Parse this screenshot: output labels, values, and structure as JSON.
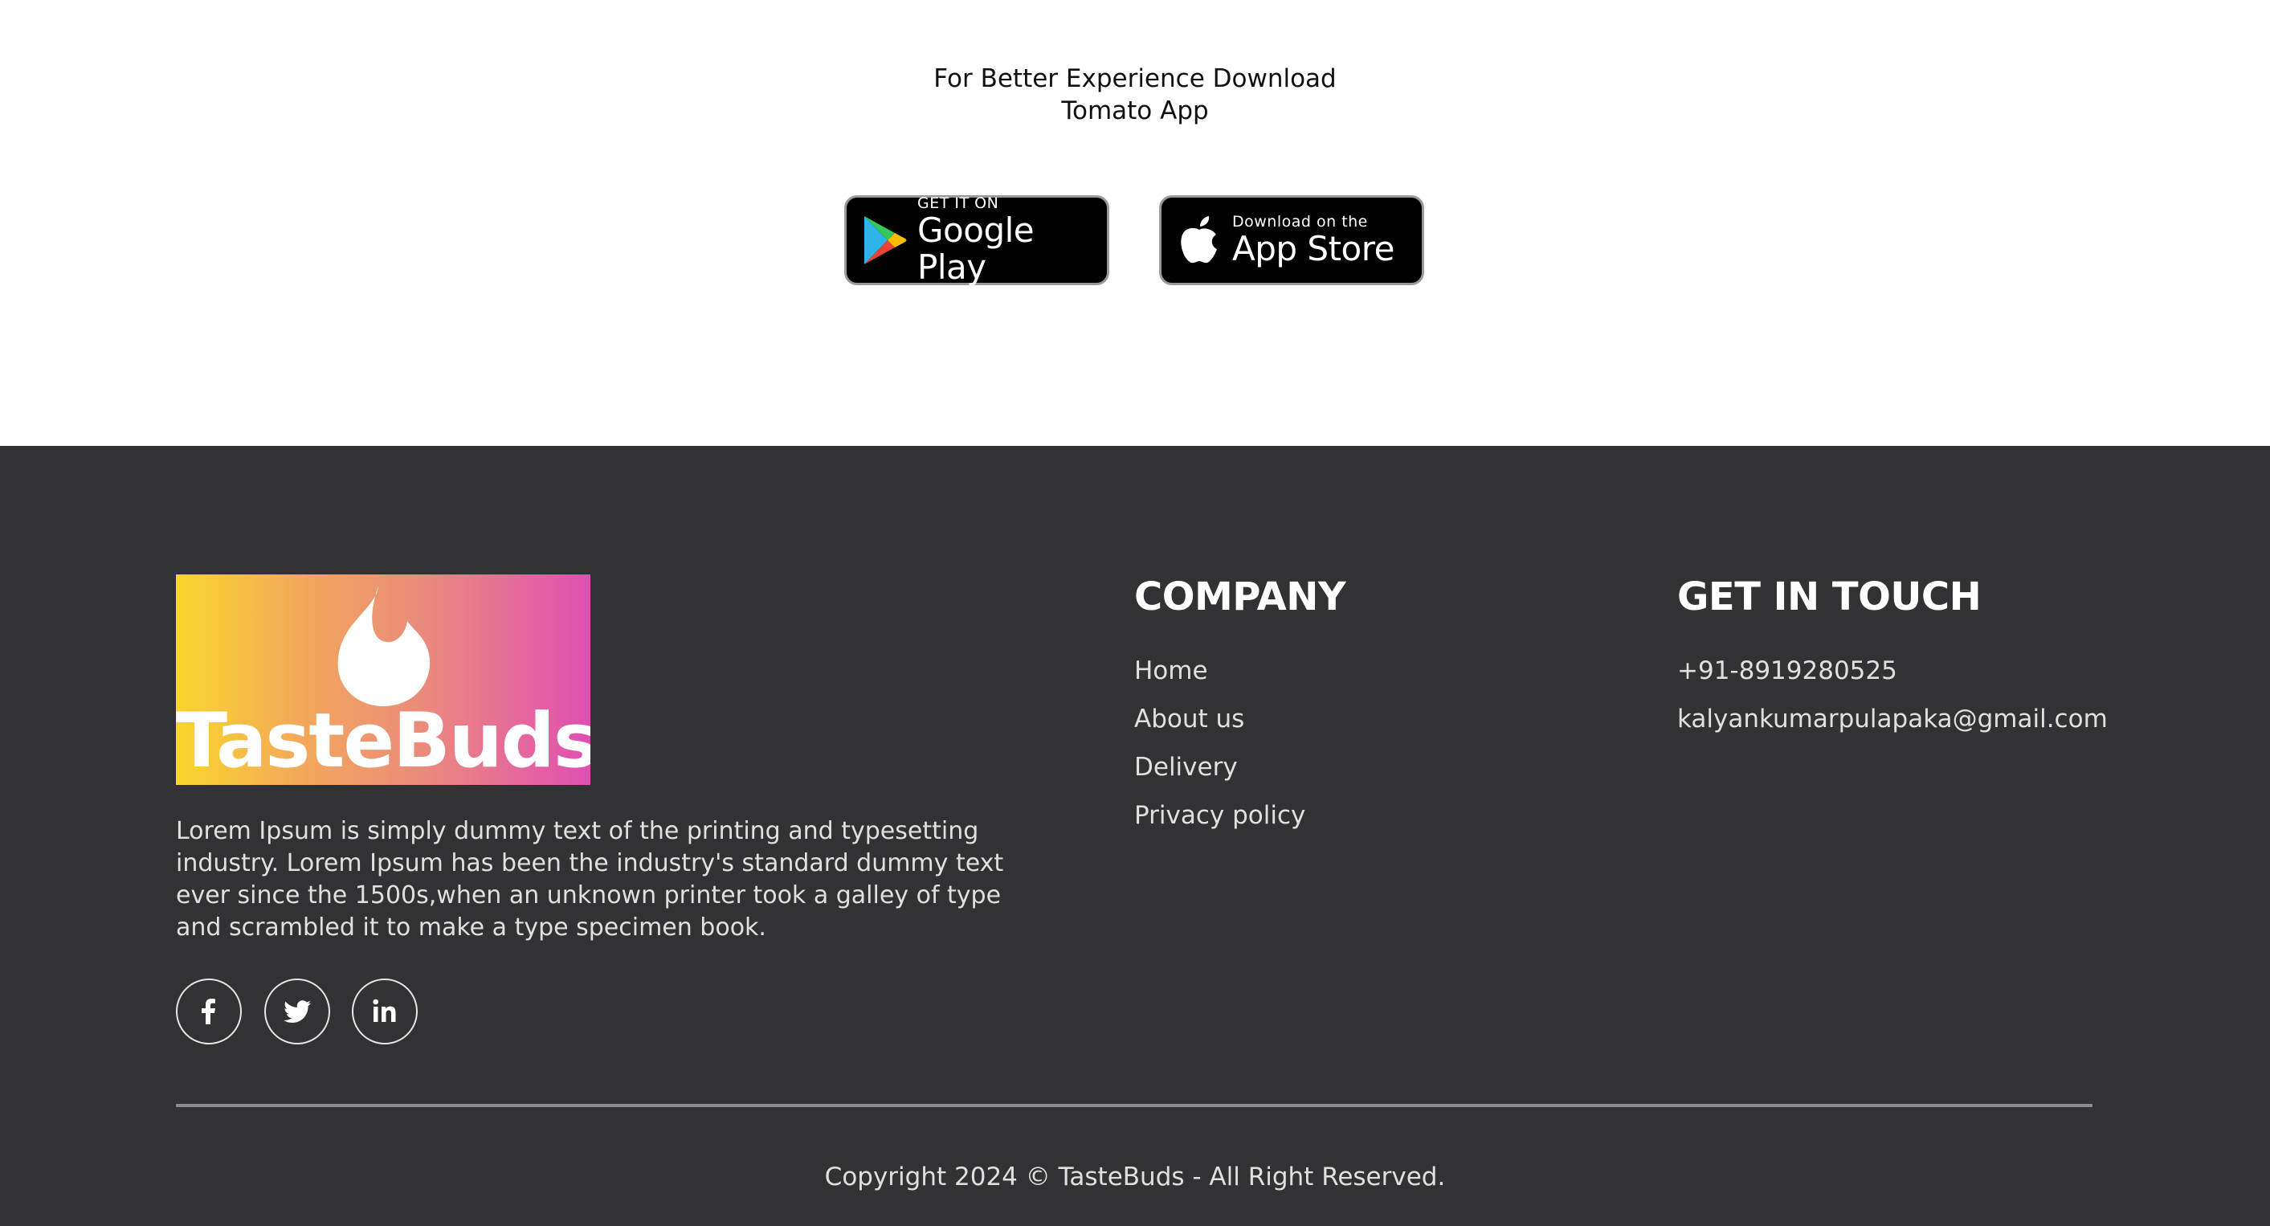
{
  "app_section": {
    "title_line1": "For Better Experience Download",
    "title_line2": "Tomato App",
    "google_play": {
      "small": "GET IT ON",
      "big": "Google Play",
      "icon": "google-play-icon"
    },
    "app_store": {
      "small": "Download on the",
      "big": "App Store",
      "icon": "apple-icon"
    }
  },
  "footer": {
    "logo": {
      "text": "TasteBuds",
      "icon": "flame-icon"
    },
    "description": "Lorem Ipsum is simply dummy text of the printing and typesetting industry. Lorem Ipsum has been the industry's standard dummy text ever since the 1500s,when an unknown printer took a galley of type and scrambled it to make a type specimen book.",
    "social": [
      {
        "name": "facebook",
        "icon": "facebook-icon"
      },
      {
        "name": "twitter",
        "icon": "twitter-icon"
      },
      {
        "name": "linkedin",
        "icon": "linkedin-icon"
      }
    ],
    "company": {
      "heading": "COMPANY",
      "links": [
        "Home",
        "About us",
        "Delivery",
        "Privacy policy"
      ]
    },
    "contact": {
      "heading": "GET IN TOUCH",
      "phone": "+91-8919280525",
      "email": "kalyankumarpulapaka@gmail.com"
    },
    "copyright": "Copyright 2024 © TasteBuds - All Right Reserved."
  },
  "colors": {
    "footer_bg": "#323234",
    "logo_gradient": [
      "#fad62b",
      "#f3a85a",
      "#ea8a7c",
      "#e04fb3"
    ],
    "store_button_bg": "#000000"
  }
}
